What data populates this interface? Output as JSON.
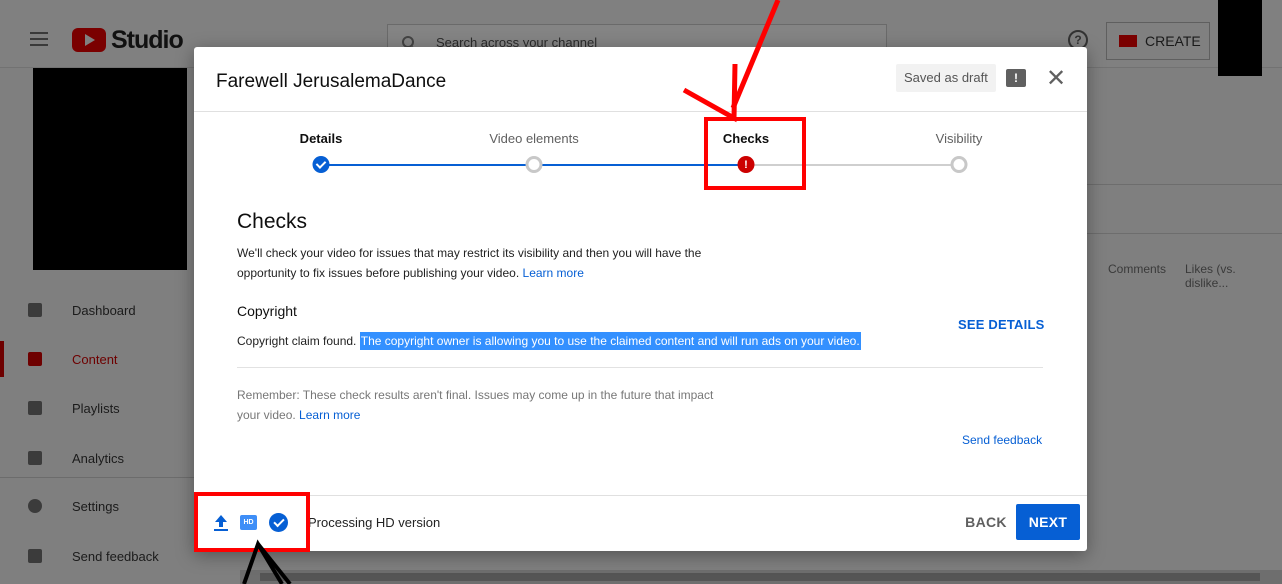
{
  "app": {
    "logo_text": "Studio",
    "search_placeholder": "Search across your channel",
    "help_glyph": "?",
    "create_label": "CREATE"
  },
  "sidebar": {
    "items": [
      {
        "label": "Dashboard",
        "icon": "dashboard-icon"
      },
      {
        "label": "Content",
        "icon": "content-icon",
        "active": true
      },
      {
        "label": "Playlists",
        "icon": "playlists-icon"
      },
      {
        "label": "Analytics",
        "icon": "analytics-icon"
      },
      {
        "label": "Settings",
        "icon": "gear-icon"
      },
      {
        "label": "Send feedback",
        "icon": "feedback-icon"
      }
    ]
  },
  "background_table": {
    "columns": [
      "Comments",
      "Likes (vs. dislike..."
    ]
  },
  "dialog": {
    "title": "Farewell JerusalemaDance",
    "status_badge": "Saved as draft",
    "feedback_glyph": "!",
    "close_glyph": "✕",
    "steps": [
      {
        "label": "Details",
        "state": "done"
      },
      {
        "label": "Video elements",
        "state": "pending"
      },
      {
        "label": "Checks",
        "state": "error",
        "glyph": "!"
      },
      {
        "label": "Visibility",
        "state": "pending"
      }
    ],
    "checks": {
      "title": "Checks",
      "description": "We'll check your video for issues that may restrict its visibility and then you will have the opportunity to fix issues before publishing your video.",
      "learn_more": "Learn more",
      "copyright_title": "Copyright",
      "copyright_prefix": "Copyright claim found.",
      "copyright_highlight": "The copyright owner is allowing you to use the claimed content and will run ads on your video.",
      "see_details": "SEE DETAILS",
      "remember": "Remember: These check results aren't final. Issues may come up in the future that impact your video.",
      "remember_link": "Learn more",
      "send_feedback": "Send feedback"
    },
    "footer": {
      "hd_label": "HD",
      "processing": "Processing HD version",
      "back": "BACK",
      "next": "NEXT"
    }
  },
  "colors": {
    "accent_blue": "#065fd4",
    "error_red": "#cc0000",
    "annotation_red": "#ff0000",
    "selection_blue": "#3390ff"
  }
}
